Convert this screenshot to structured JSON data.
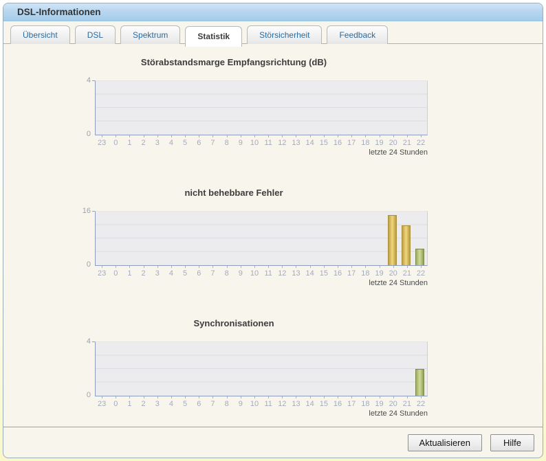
{
  "window": {
    "title": "DSL-Informationen"
  },
  "tabs": [
    {
      "label": "Übersicht",
      "active": false
    },
    {
      "label": "DSL",
      "active": false
    },
    {
      "label": "Spektrum",
      "active": false
    },
    {
      "label": "Statistik",
      "active": true
    },
    {
      "label": "Störsicherheit",
      "active": false
    },
    {
      "label": "Feedback",
      "active": false
    }
  ],
  "footer": {
    "refresh_label": "Aktualisieren",
    "help_label": "Hilfe"
  },
  "colors": {
    "titlebar_top": "#d2e5f6",
    "titlebar_bottom": "#a6cce9",
    "content_bg": "#f8f6ec",
    "plot_bg": "#ececee",
    "axis": "#8e9cbd",
    "gridline": "#d9dce3",
    "bar_yellow": "#e3c367",
    "bar_green": "#b4c47c",
    "tab_text_blue": "#2a6a9f"
  },
  "chart_data": [
    {
      "type": "bar",
      "title": "Störabstandsmarge Empfangsrichtung (dB)",
      "xlabel": "",
      "ylabel": "",
      "ylim": [
        0,
        4
      ],
      "ymax_label": "4",
      "ymin_label": "0",
      "grid": true,
      "categories": [
        "23",
        "0",
        "1",
        "2",
        "3",
        "4",
        "5",
        "6",
        "7",
        "8",
        "9",
        "10",
        "11",
        "12",
        "13",
        "14",
        "15",
        "16",
        "17",
        "18",
        "19",
        "20",
        "21",
        "22"
      ],
      "bars": [],
      "xnote": "letzte 24 Stunden"
    },
    {
      "type": "bar",
      "title": "nicht behebbare Fehler",
      "xlabel": "",
      "ylabel": "",
      "ylim": [
        0,
        16
      ],
      "ymax_label": "16",
      "ymin_label": "0",
      "grid": true,
      "categories": [
        "23",
        "0",
        "1",
        "2",
        "3",
        "4",
        "5",
        "6",
        "7",
        "8",
        "9",
        "10",
        "11",
        "12",
        "13",
        "14",
        "15",
        "16",
        "17",
        "18",
        "19",
        "20",
        "21",
        "22"
      ],
      "bars": [
        {
          "hour": "20",
          "value": 15,
          "color": "yellow"
        },
        {
          "hour": "21",
          "value": 12,
          "color": "yellow"
        },
        {
          "hour": "22",
          "value": 5,
          "color": "green"
        }
      ],
      "xnote": "letzte 24 Stunden"
    },
    {
      "type": "bar",
      "title": "Synchronisationen",
      "xlabel": "",
      "ylabel": "",
      "ylim": [
        0,
        4
      ],
      "ymax_label": "4",
      "ymin_label": "0",
      "grid": true,
      "categories": [
        "23",
        "0",
        "1",
        "2",
        "3",
        "4",
        "5",
        "6",
        "7",
        "8",
        "9",
        "10",
        "11",
        "12",
        "13",
        "14",
        "15",
        "16",
        "17",
        "18",
        "19",
        "20",
        "21",
        "22"
      ],
      "bars": [
        {
          "hour": "22",
          "value": 2,
          "color": "green"
        }
      ],
      "xnote": "letzte 24 Stunden"
    }
  ]
}
